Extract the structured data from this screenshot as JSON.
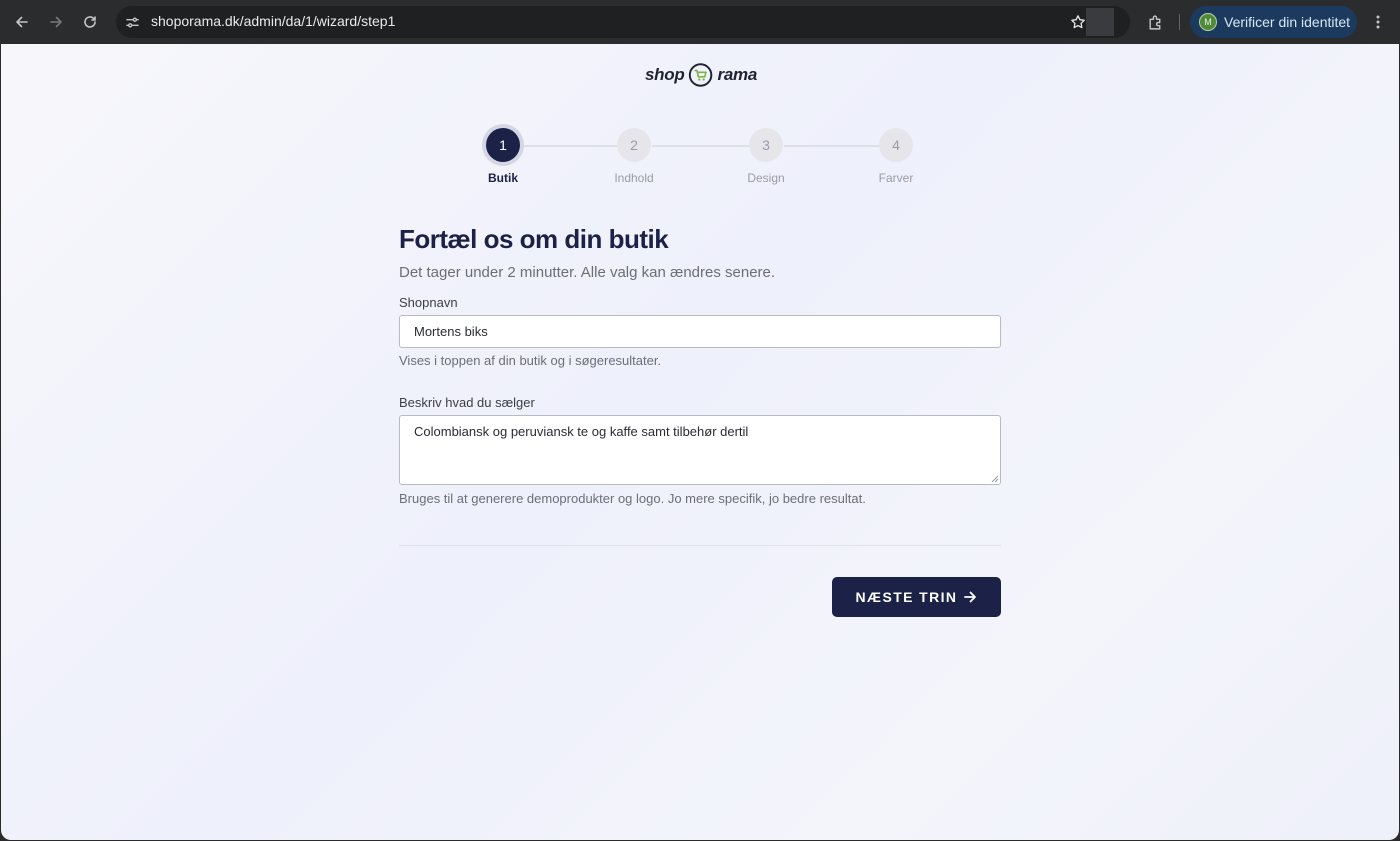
{
  "browser": {
    "url": "shoporama.dk/admin/da/1/wizard/step1",
    "profile_label": "Verificer din identitet",
    "profile_initial": "M"
  },
  "logo": {
    "left": "shop",
    "right": "rama"
  },
  "stepper": {
    "steps": [
      {
        "number": "1",
        "label": "Butik",
        "state": "active"
      },
      {
        "number": "2",
        "label": "Indhold",
        "state": "idle"
      },
      {
        "number": "3",
        "label": "Design",
        "state": "idle"
      },
      {
        "number": "4",
        "label": "Farver",
        "state": "idle"
      }
    ]
  },
  "form": {
    "title": "Fortæl os om din butik",
    "subtitle": "Det tager under 2 minutter. Alle valg kan ændres senere.",
    "shop_name": {
      "label": "Shopnavn",
      "value": "Mortens biks",
      "hint": "Vises i toppen af din butik og i søgeresultater."
    },
    "description": {
      "label": "Beskriv hvad du sælger",
      "value": "Colombiansk og peruviansk te og kaffe samt tilbehør dertil",
      "hint": "Bruges til at generere demoprodukter og logo. Jo mere specifik, jo bedre resultat."
    },
    "next_label": "NÆSTE TRIN"
  },
  "colors": {
    "primary": "#1b2147",
    "logo_accent": "#7bb342"
  }
}
